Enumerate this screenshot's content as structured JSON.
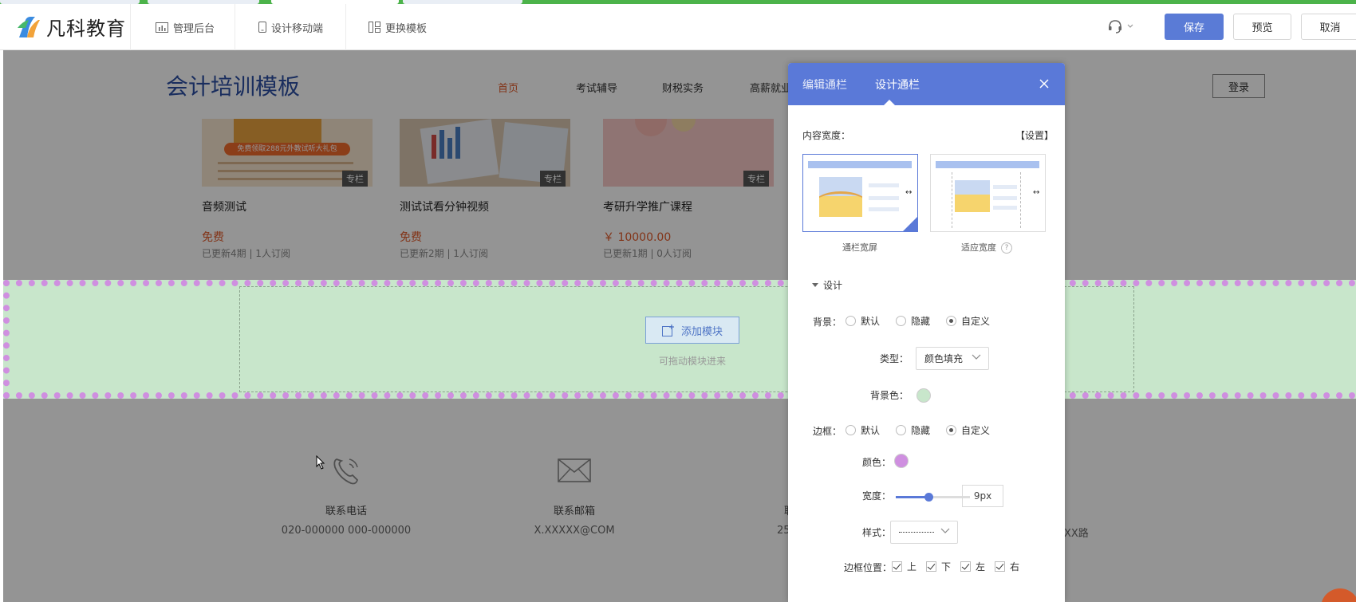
{
  "toolbar": {
    "logo_text": "凡科教育",
    "admin_label": "管理后台",
    "mobile_label": "设计移动端",
    "template_label": "更换模板",
    "save_label": "保存",
    "preview_label": "预览",
    "cancel_label": "取消"
  },
  "site": {
    "title": "会计培训模板",
    "nav": [
      "首页",
      "考试辅导",
      "财税实务",
      "高薪就业"
    ],
    "login_label": "登录",
    "courses": [
      {
        "title": "音频测试",
        "price": "免费",
        "meta": "已更新4期 | 1人订阅",
        "tag": "专栏",
        "banner": "免费领取288元外教试听大礼包"
      },
      {
        "title": "测试试看分钟视频",
        "price": "免费",
        "meta": "已更新2期 | 1人订阅",
        "tag": "专栏"
      },
      {
        "title": "考研升学推广课程",
        "price": "￥ 10000.00",
        "meta": "已更新1期 | 0人订阅",
        "tag": "专栏"
      }
    ],
    "add_module_label": "添加模块",
    "drag_hint": "可拖动模块进来",
    "footer": [
      {
        "icon": "phone-icon",
        "label": "联系电话",
        "value": "020-000000 000-000000"
      },
      {
        "icon": "mail-icon",
        "label": "联系邮箱",
        "value": "X.XXXXX@COM"
      }
    ],
    "footer_partial": {
      "col3_label": "联",
      "col3_value": "25",
      "col4_value": "XX路"
    }
  },
  "panel": {
    "tabs": [
      "编辑通栏",
      "设计通栏"
    ],
    "active_tab": "设计通栏",
    "content_width_label": "内容宽度：",
    "settings_link": "【设置】",
    "layout_options": [
      "通栏宽屏",
      "适应宽度"
    ],
    "design_section": "设计",
    "background": {
      "label": "背景：",
      "options": [
        "默认",
        "隐藏",
        "自定义"
      ],
      "selected": "自定义",
      "type_label": "类型：",
      "type_value": "颜色填充",
      "color_label": "背景色：",
      "color": "#c8e6cb"
    },
    "border": {
      "label": "边框：",
      "options": [
        "默认",
        "隐藏",
        "自定义"
      ],
      "selected": "自定义",
      "color_label": "颜色：",
      "color": "#cf8fe0",
      "width_label": "宽度：",
      "width_value": "9px",
      "width_fraction": 0.45,
      "style_label": "样式：",
      "position_label": "边框位置：",
      "positions": [
        "上",
        "下",
        "左",
        "右"
      ]
    }
  },
  "colors": {
    "accent": "#5a79d8",
    "price": "#e15a2a",
    "brand_title": "#2c4fa3"
  }
}
